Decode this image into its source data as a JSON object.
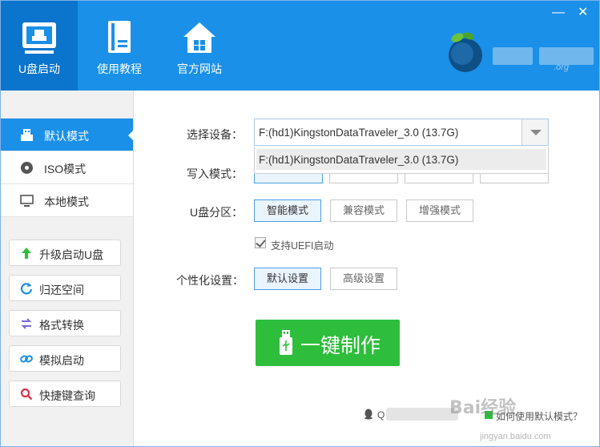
{
  "header": {
    "tabs": [
      {
        "label": "U盘启动",
        "icon": "usb-monitor-icon",
        "active": true
      },
      {
        "label": "使用教程",
        "icon": "book-icon",
        "active": false
      },
      {
        "label": "官方网站",
        "icon": "home-icon",
        "active": false
      }
    ],
    "brand_domain": ".org",
    "window_controls": {
      "minimize": "—",
      "close": "✕"
    }
  },
  "sidebar": {
    "modes": [
      {
        "label": "默认模式",
        "icon": "usb-drive-icon",
        "active": true
      },
      {
        "label": "ISO模式",
        "icon": "disc-icon",
        "active": false
      },
      {
        "label": "本地模式",
        "icon": "monitor-icon",
        "active": false
      }
    ],
    "tools": [
      {
        "label": "升级启动U盘",
        "icon": "up-arrow-icon"
      },
      {
        "label": "归还空间",
        "icon": "refresh-icon"
      },
      {
        "label": "格式转换",
        "icon": "swap-icon"
      },
      {
        "label": "模拟启动",
        "icon": "link-icon"
      },
      {
        "label": "快捷键查询",
        "icon": "search-icon"
      }
    ]
  },
  "main": {
    "device_label": "选择设备：",
    "device_value": "F:(hd1)KingstonDataTraveler_3.0 (13.7G)",
    "device_options": [
      "F:(hd1)KingstonDataTraveler_3.0 (13.7G)"
    ],
    "write_label": "写入模式：",
    "partition_label": "U盘分区：",
    "partition_options": [
      {
        "label": "智能模式",
        "selected": true
      },
      {
        "label": "兼容模式",
        "selected": false
      },
      {
        "label": "增强模式",
        "selected": false
      }
    ],
    "uefi_label": "支持UEFI启动",
    "uefi_checked": true,
    "personal_label": "个性化设置：",
    "personal_options": [
      {
        "label": "默认设置",
        "selected": true
      },
      {
        "label": "高级设置",
        "selected": false
      }
    ],
    "make_button": "一键制作",
    "footer_qq": "Q",
    "footer_help": "如何使用默认模式？"
  },
  "watermark": {
    "text": "Bai经验",
    "sub": "jingyan.baidu.com"
  },
  "colors": {
    "header": "#1a90e8",
    "active_tab": "#0b74cc",
    "make_button": "#2ebe3b"
  }
}
